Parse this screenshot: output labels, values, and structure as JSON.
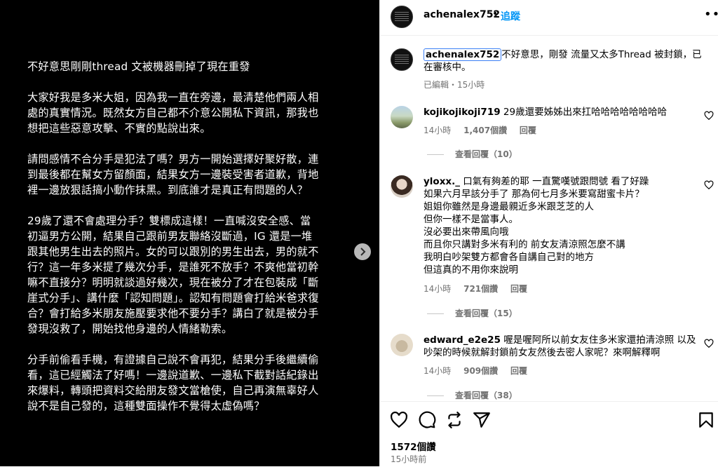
{
  "post_image": {
    "paragraphs": [
      "不好意思剛剛thread 文被機器刪掉了現在重發",
      "大家好我是多米大姐，因為我一直在旁邊，最清楚他們兩人相處的真實情況。既然女方自己都不介意公開私下資訊，那我也想把這些惡意攻擊、不實的點說出來。",
      "請問感情不合分手是犯法了嗎？男方一開始選擇好聚好散，連到最後都在幫女方留顏面，結果女方一邊裝受害者道歉，背地裡一邊放狠話搞小動作抹黑。到底誰才是真正有問題的人？",
      "29歲了還不會處理分手？雙標成這樣！一直喊沒安全感、當初逼男方公開，結果自己跟前男友聯絡沒斷過，IG 還是一堆跟其他男生出去的照片。女的可以跟別的男生出去，男的就不行？這一年多米提了幾次分手，是誰死不放手？不爽他當初幹嘛不直接分？明明就談過好幾次，現在被分了才在包裝成「斷崖式分手」、講什麼「認知問題」。認知有問題會打給米爸求復合？會打給多米朋友施壓要求他不要分手？講白了就是被分手發現沒救了，開始找他身邊的人情緒勒索。",
      "分手前偷看手機，有證據自己說不會再犯，結果分手後繼續偷看，這已經觸法了好嗎！一邊說道歉、一邊私下截對話紀錄出來爆料，轉頭把資料交給朋友發文當槍使，自己再演無辜好人說不是自己發的，這種雙面操作不覺得太虛偽嗎？"
    ],
    "next_icon": "chevron-right-icon"
  },
  "header": {
    "username": "achenalex752",
    "separator": "•",
    "follow_label": "追蹤",
    "more_icon": "more-horizontal-icon"
  },
  "caption": {
    "username": "achenalex752",
    "text": "不好意思，剛發 流量又太多Thread 被封鎖，已在審核中。",
    "edited": "已編輯・15小時"
  },
  "comments": [
    {
      "username": "kojikojikoji719",
      "text": "29歲還要姊姊出來扛哈哈哈哈哈哈哈哈",
      "time": "14小時",
      "likes": "1,407個讚",
      "reply_label": "回覆",
      "view_replies": "查看回覆（10）"
    },
    {
      "username": "yloxx._",
      "lines": [
        "口氣有夠差的耶 一直驚嘆號跟問號 看了好躁",
        "如果六月早該分手了 那為何七月多米要寫甜蜜卡片？",
        "姐姐你雖然是身邊最親近多米跟芝芝的人",
        "但你一樣不是當事人。",
        "沒必要出來帶風向哦",
        "而且你只講對多米有利的 前女友清涼照怎麼不講",
        "我明白吵架雙方都會各自講自己對的地方",
        "但這真的不用你來說明"
      ],
      "time": "14小時",
      "likes": "721個讚",
      "reply_label": "回覆",
      "view_replies": "查看回覆（15）"
    },
    {
      "username": "edward_e2e25",
      "lines": [
        "喔是喔阿所以前女友住多米家還拍清涼照 以及",
        "吵架的時候就解封鎖前女友然後去密人家呢？來啊解釋啊"
      ],
      "time": "14小時",
      "likes": "909個讚",
      "reply_label": "回覆",
      "view_replies": "查看回覆（38）"
    }
  ],
  "actions": {
    "icons": [
      "heart-icon",
      "comment-icon",
      "repost-icon",
      "share-icon",
      "save-icon"
    ],
    "likes": "1572個讚",
    "time_ago": "15小時前"
  }
}
